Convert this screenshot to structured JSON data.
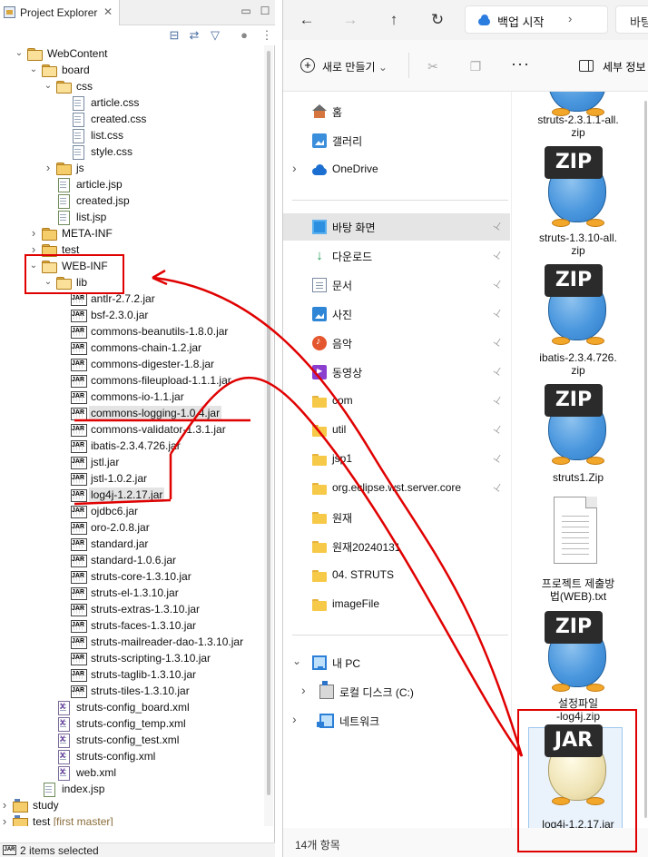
{
  "eclipse": {
    "tab_title": "Project Explorer",
    "tab_close": "✕",
    "minimize": "▭",
    "maximize": "☐",
    "toolbar_icons": [
      "collapse-all-icon",
      "link-editor-icon",
      "filter-icon",
      "focus-icon",
      "view-menu-icon"
    ],
    "tree": [
      {
        "label": "WebContent",
        "type": "folder",
        "open": true
      },
      {
        "label": "board",
        "type": "folder",
        "open": true
      },
      {
        "label": "css",
        "type": "folder",
        "open": true
      },
      {
        "label": "article.css",
        "type": "file"
      },
      {
        "label": "created.css",
        "type": "file"
      },
      {
        "label": "list.css",
        "type": "file"
      },
      {
        "label": "style.css",
        "type": "file"
      },
      {
        "label": "js",
        "type": "folder",
        "open": false
      },
      {
        "label": "article.jsp",
        "type": "file"
      },
      {
        "label": "created.jsp",
        "type": "file"
      },
      {
        "label": "list.jsp",
        "type": "file"
      },
      {
        "label": "META-INF",
        "type": "folder",
        "open": false
      },
      {
        "label": "test",
        "type": "folder",
        "open": false
      },
      {
        "label": "WEB-INF",
        "type": "folder",
        "open": true
      },
      {
        "label": "lib",
        "type": "folder",
        "open": true
      },
      {
        "label": "antlr-2.7.2.jar",
        "type": "jar"
      },
      {
        "label": "bsf-2.3.0.jar",
        "type": "jar"
      },
      {
        "label": "commons-beanutils-1.8.0.jar",
        "type": "jar"
      },
      {
        "label": "commons-chain-1.2.jar",
        "type": "jar"
      },
      {
        "label": "commons-digester-1.8.jar",
        "type": "jar"
      },
      {
        "label": "commons-fileupload-1.1.1.jar",
        "type": "jar"
      },
      {
        "label": "commons-io-1.1.jar",
        "type": "jar"
      },
      {
        "label": "commons-logging-1.0.4.jar",
        "type": "jar",
        "selected": true
      },
      {
        "label": "commons-validator-1.3.1.jar",
        "type": "jar"
      },
      {
        "label": "ibatis-2.3.4.726.jar",
        "type": "jar"
      },
      {
        "label": "jstl.jar",
        "type": "jar"
      },
      {
        "label": "jstl-1.0.2.jar",
        "type": "jar"
      },
      {
        "label": "log4j-1.2.17.jar",
        "type": "jar",
        "selected": true
      },
      {
        "label": "ojdbc6.jar",
        "type": "jar"
      },
      {
        "label": "oro-2.0.8.jar",
        "type": "jar"
      },
      {
        "label": "standard.jar",
        "type": "jar"
      },
      {
        "label": "standard-1.0.6.jar",
        "type": "jar"
      },
      {
        "label": "struts-core-1.3.10.jar",
        "type": "jar"
      },
      {
        "label": "struts-el-1.3.10.jar",
        "type": "jar"
      },
      {
        "label": "struts-extras-1.3.10.jar",
        "type": "jar"
      },
      {
        "label": "struts-faces-1.3.10.jar",
        "type": "jar"
      },
      {
        "label": "struts-mailreader-dao-1.3.10.jar",
        "type": "jar"
      },
      {
        "label": "struts-scripting-1.3.10.jar",
        "type": "jar"
      },
      {
        "label": "struts-taglib-1.3.10.jar",
        "type": "jar"
      },
      {
        "label": "struts-tiles-1.3.10.jar",
        "type": "jar"
      },
      {
        "label": "struts-config_board.xml",
        "type": "xml"
      },
      {
        "label": "struts-config_temp.xml",
        "type": "xml"
      },
      {
        "label": "struts-config_test.xml",
        "type": "xml"
      },
      {
        "label": "struts-config.xml",
        "type": "xml"
      },
      {
        "label": "web.xml",
        "type": "xml"
      },
      {
        "label": "index.jsp",
        "type": "file"
      },
      {
        "label": "study",
        "type": "project",
        "open": false
      },
      {
        "label": "test",
        "decoration": "[first master]",
        "type": "project",
        "open": false
      }
    ],
    "status": "2 items selected"
  },
  "explorer": {
    "nav": {
      "back": "←",
      "forward": "→",
      "up": "↑",
      "refresh": "↻"
    },
    "breadcrumb": {
      "label": "백업 시작",
      "arrow": "›",
      "next_partial": "바탕"
    },
    "commands": {
      "new_label": "새로 만들기",
      "new_caret": "⌄",
      "more": "···",
      "details_label": "세부 정보"
    },
    "sidebar": [
      {
        "label": "홈",
        "icon": "home-icon"
      },
      {
        "label": "갤러리",
        "icon": "gallery-icon"
      },
      {
        "label": "OneDrive",
        "icon": "onedrive-icon",
        "expandable": true
      },
      {
        "label": "바탕 화면",
        "icon": "desktop-icon",
        "pinned": true,
        "active": true
      },
      {
        "label": "다운로드",
        "icon": "download-icon",
        "pinned": true
      },
      {
        "label": "문서",
        "icon": "documents-icon",
        "pinned": true
      },
      {
        "label": "사진",
        "icon": "pictures-icon",
        "pinned": true
      },
      {
        "label": "음악",
        "icon": "music-icon",
        "pinned": true
      },
      {
        "label": "동영상",
        "icon": "videos-icon",
        "pinned": true
      },
      {
        "label": "com",
        "icon": "folder-icon",
        "pinned": true
      },
      {
        "label": "util",
        "icon": "folder-icon",
        "pinned": true
      },
      {
        "label": "jsp1",
        "icon": "folder-icon",
        "pinned": true
      },
      {
        "label": "org.eclipse.wst.server.core",
        "icon": "folder-icon",
        "pinned": true
      },
      {
        "label": "원재",
        "icon": "folder-icon"
      },
      {
        "label": "원재20240131",
        "icon": "folder-icon"
      },
      {
        "label": "04. STRUTS",
        "icon": "folder-icon"
      },
      {
        "label": "imageFile",
        "icon": "folder-icon"
      },
      {
        "label": "내 PC",
        "icon": "pc-icon",
        "expandable": true,
        "open": true
      },
      {
        "label": "로컬 디스크 (C:)",
        "icon": "disk-icon",
        "expandable": true
      },
      {
        "label": "네트워크",
        "icon": "network-icon",
        "expandable": true
      }
    ],
    "pin_glyph": "📌",
    "files": [
      {
        "name_line1": "struts-2.3.1.1-all.",
        "name_line2": "zip",
        "kind": "zip",
        "badge": ""
      },
      {
        "name_line1": "struts-1.3.10-all.",
        "name_line2": "zip",
        "kind": "zip",
        "badge": "ZIP"
      },
      {
        "name_line1": "ibatis-2.3.4.726.",
        "name_line2": "zip",
        "kind": "zip",
        "badge": "ZIP"
      },
      {
        "name_line1": "struts1.Zip",
        "name_line2": "",
        "kind": "zip",
        "badge": "ZIP"
      },
      {
        "name_line1": "프로젝트 제출방",
        "name_line2": "법(WEB).txt",
        "kind": "txt",
        "badge": ""
      },
      {
        "name_line1": "설정파일",
        "name_line2": "-log4j.zip",
        "kind": "zip",
        "badge": "ZIP"
      },
      {
        "name_line1": "log4j-1.2.17.jar",
        "name_line2": "",
        "kind": "jar",
        "badge": "JAR"
      }
    ],
    "status": "14개 항목"
  },
  "annotation_color": "#e00000"
}
